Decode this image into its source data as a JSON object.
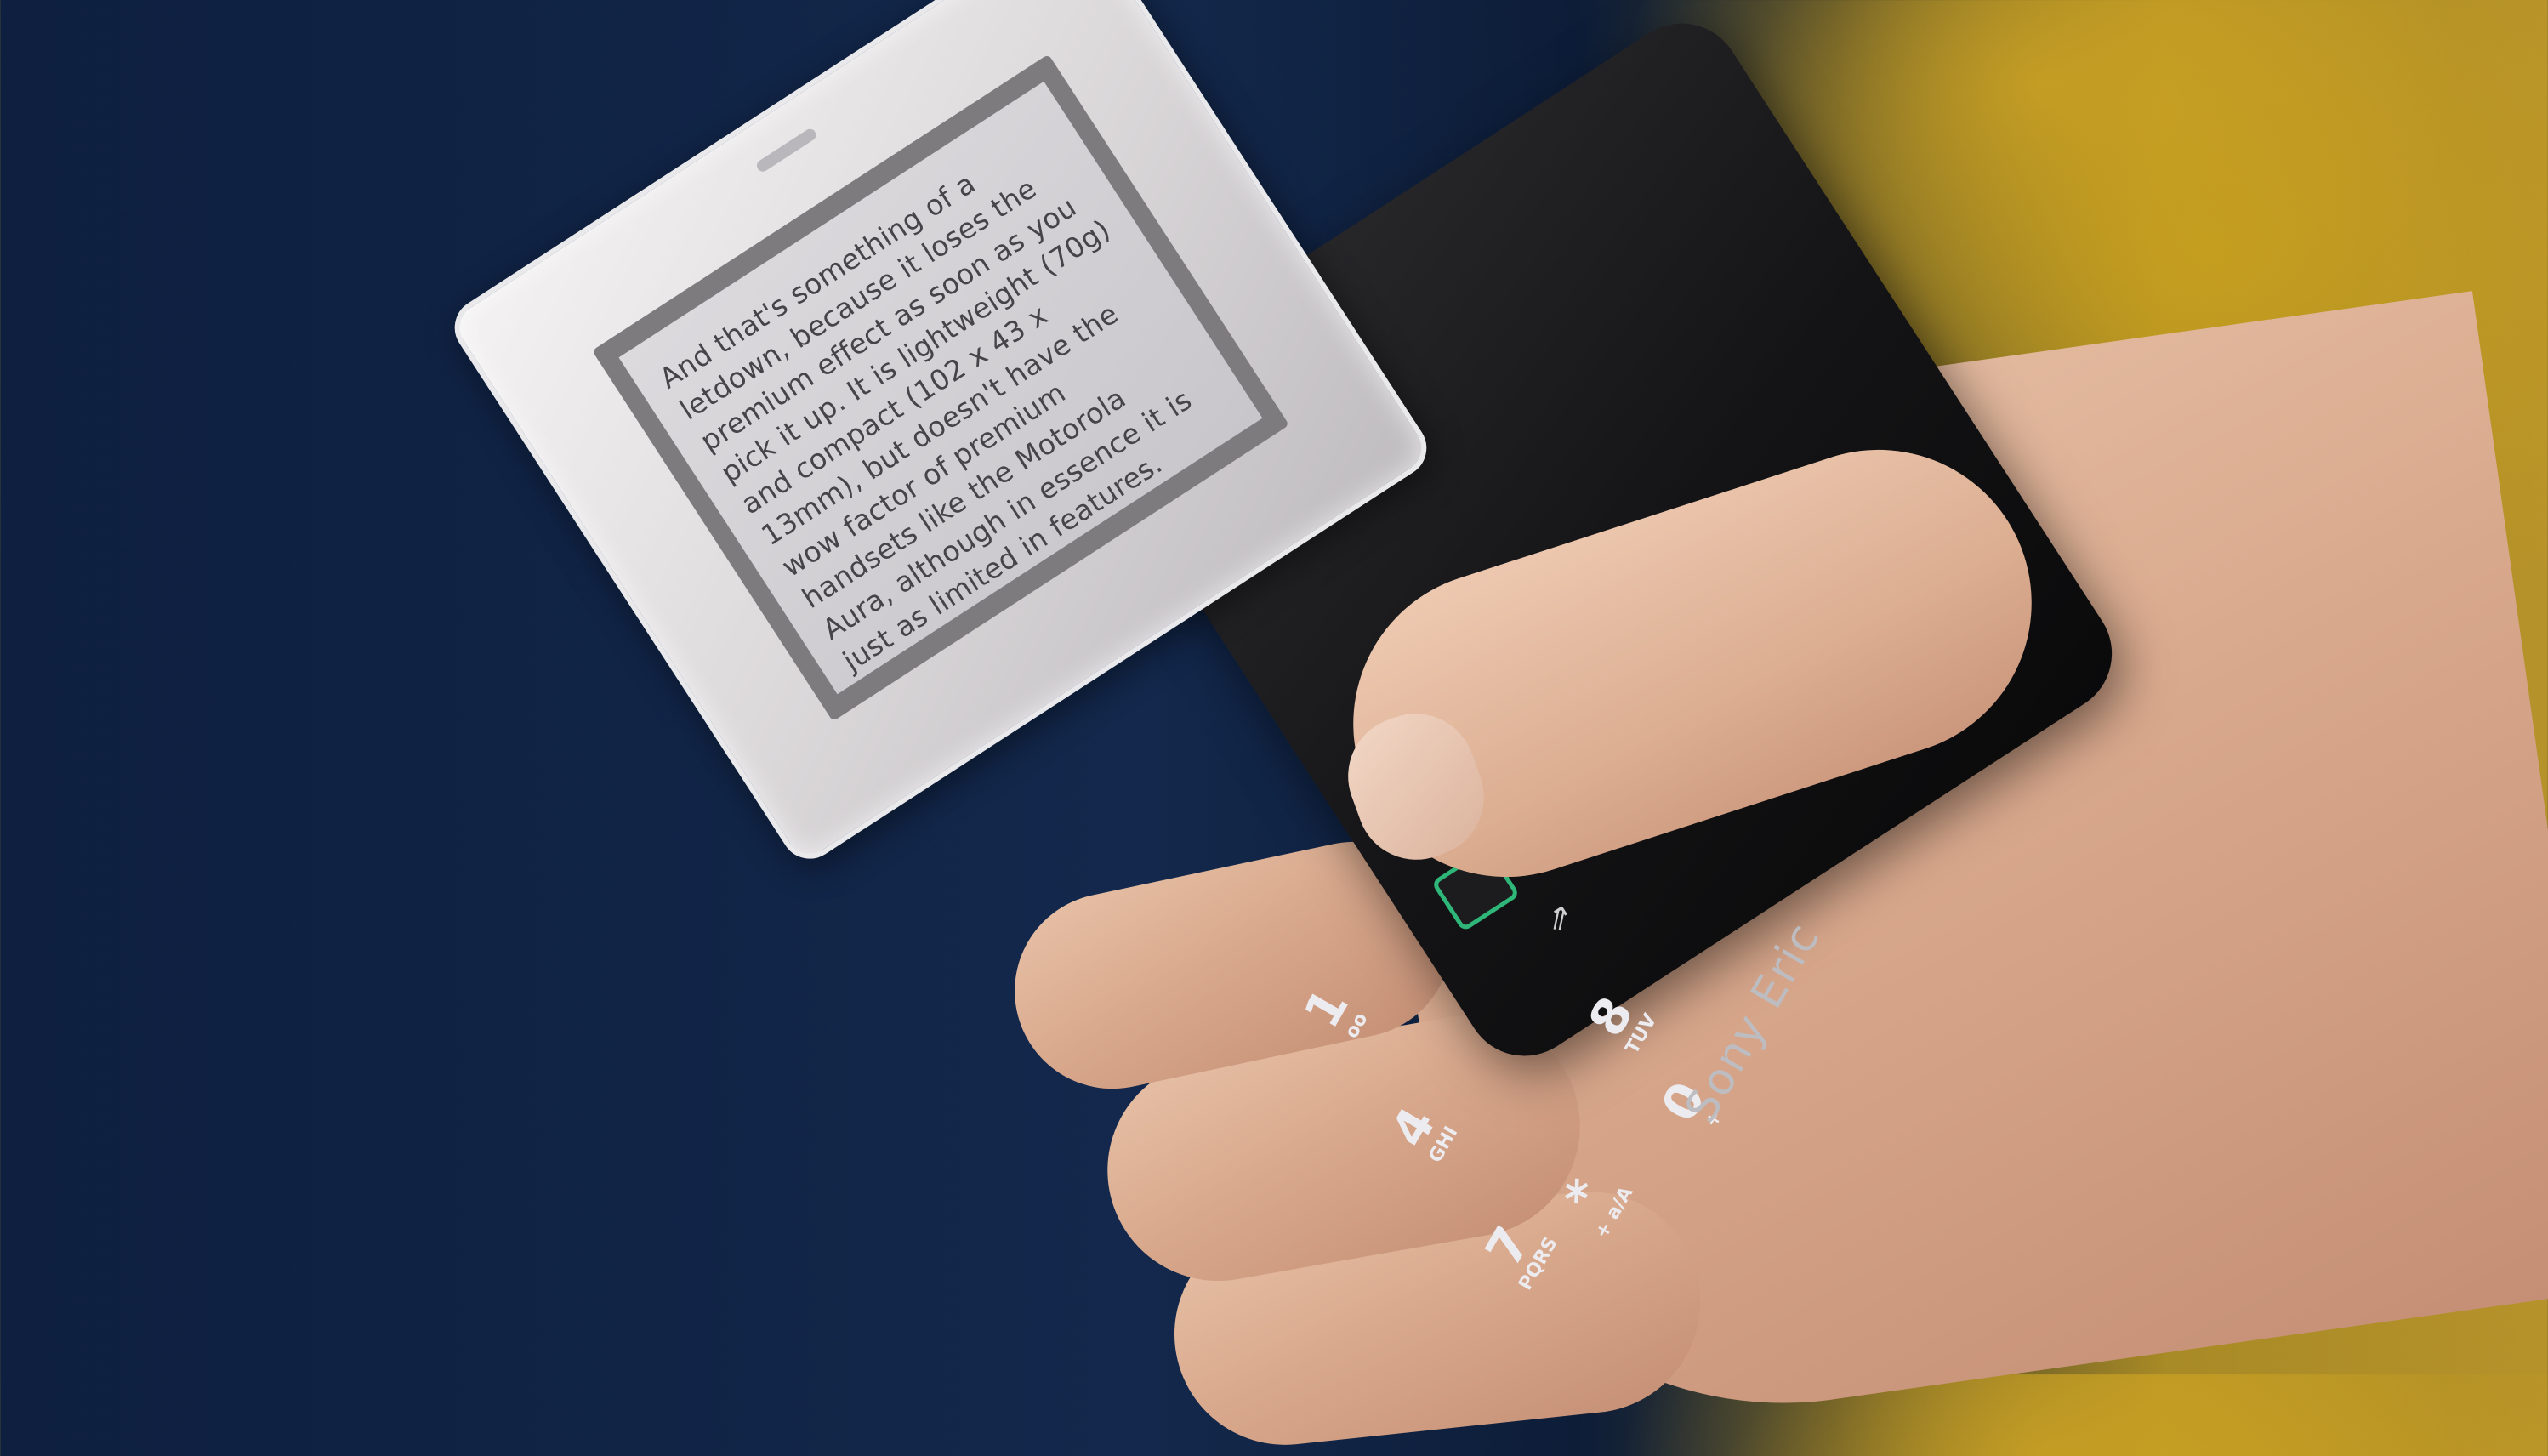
{
  "screen": {
    "text": "And that's something of a\nletdown, because it loses the\npremium effect as soon as you\npick it up. It is lightweight (70g)\nand compact (102 x 43 x\n13mm), but doesn't have the\nwow factor of premium\nhandsets like the Motorola\nAura, although in essence it is\njust as limited in features.\nSony Ericsson launched the"
  },
  "keypad": {
    "keys": [
      {
        "digit": "1",
        "letters": "oo"
      },
      {
        "digit": "4",
        "letters": "GHI"
      },
      {
        "digit": "7",
        "letters": "PQRS"
      },
      {
        "digit": "8",
        "letters": "TUV"
      },
      {
        "digit": "0",
        "letters": "+"
      },
      {
        "digit": "*",
        "letters": "+ a/A"
      }
    ]
  },
  "brand": "Sony Eric",
  "colors": {
    "background_blue": "#13284c",
    "background_yellow": "#b6922a",
    "softkey_red": "#c6382f",
    "softkey_green": "#2fb77a"
  },
  "icons": [
    "share-icon"
  ]
}
